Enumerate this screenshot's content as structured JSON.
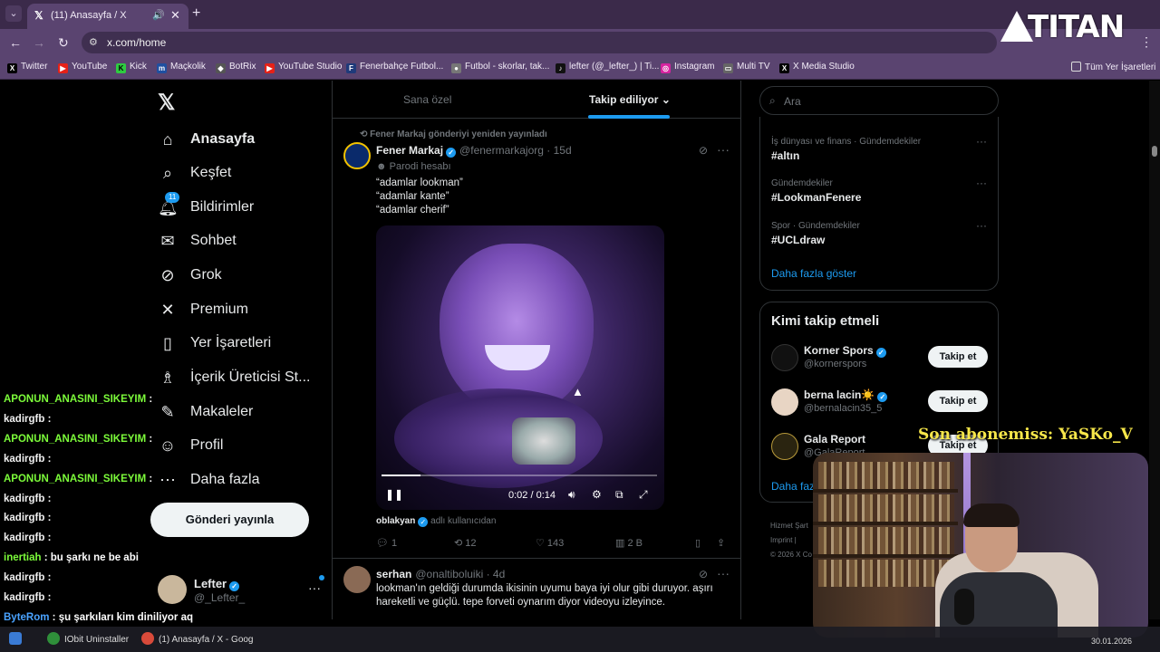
{
  "browser": {
    "tab_title": "(11) Anasayfa / X",
    "url": "x.com/home",
    "bookmarks": [
      "Twitter",
      "YouTube",
      "Kick",
      "Maçkolik",
      "BotRix",
      "YouTube Studio",
      "Fenerbahçe Futbol...",
      "Futbol - skorlar, tak...",
      "lefter (@_lefter_) | Ti...",
      "Instagram",
      "Multi TV",
      "X Media Studio"
    ],
    "all_bookmarks": "Tüm Yer İşaretleri"
  },
  "nav": {
    "items": [
      {
        "label": "Anasayfa",
        "icon": "home-icon"
      },
      {
        "label": "Keşfet",
        "icon": "search-icon"
      },
      {
        "label": "Bildirimler",
        "icon": "bell-icon",
        "badge": "11"
      },
      {
        "label": "Sohbet",
        "icon": "mail-icon"
      },
      {
        "label": "Grok",
        "icon": "grok-icon"
      },
      {
        "label": "Premium",
        "icon": "x-icon"
      },
      {
        "label": "Yer İşaretleri",
        "icon": "bookmark-icon"
      },
      {
        "label": "İçerik Üreticisi St...",
        "icon": "creator-icon"
      },
      {
        "label": "Makaleler",
        "icon": "article-icon"
      },
      {
        "label": "Profil",
        "icon": "person-icon"
      },
      {
        "label": "Daha fazla",
        "icon": "more-circle-icon"
      }
    ],
    "post_button": "Gönderi yayınla",
    "account": {
      "name": "Lefter",
      "handle": "@_Lefter_"
    }
  },
  "timeline": {
    "tabs": [
      "Sana özel",
      "Takip ediliyor"
    ],
    "post1": {
      "repost_line": "Fener Markaj gönderiyi yeniden yayınladı",
      "name": "Fener Markaj",
      "handle": "@fenermarkajorg · 15d",
      "parody": "Parodi hesabı",
      "text_lines": [
        "“adamlar lookman”",
        "“adamlar kante”",
        "“adamlar cherif”"
      ],
      "video": {
        "time": "0:02 / 0:14",
        "progress": 0.14
      },
      "tagged_name": "oblakyan",
      "tagged_suffix": "adlı kullanıcıdan",
      "replies": "1",
      "reposts": "12",
      "likes": "143",
      "views": "2 B"
    },
    "post2": {
      "name": "serhan",
      "handle": "@onaltiboluiki · 4d",
      "text": "lookman'ın geldiği durumda ikisinin uyumu baya iyi olur gibi duruyor. aşırı hareketli ve güçlü. tepe forveti oynarım diyor videoyu izleyince."
    }
  },
  "sidebar": {
    "search_placeholder": "Ara",
    "trends": [
      {
        "category": "İş dünyası ve finans · Gündemdekiler",
        "name": "#altın"
      },
      {
        "category": "Gündemdekiler",
        "name": "#LookmanFenere"
      },
      {
        "category": "Spor · Gündemdekiler",
        "name": "#UCLdraw"
      }
    ],
    "trends_show_more": "Daha fazla göster",
    "who_to_follow": {
      "title": "Kimi takip etmeli",
      "items": [
        {
          "name": "Korner Spors",
          "handle": "@kornerspors",
          "button": "Takip et"
        },
        {
          "name": "berna lacin☀️",
          "handle": "@bernalacin35_5",
          "button": "Takip et"
        },
        {
          "name": "Gala Report",
          "handle": "@GalaReport",
          "button": "Takip et"
        }
      ],
      "show_more": "Daha fazla göster"
    },
    "footer": [
      "Hizmet Şart",
      "Imprint |",
      "© 2026 X Co"
    ]
  },
  "stream": {
    "chat": [
      {
        "name": "APONUN_ANASINI_SIKEYIM",
        "msg": "",
        "color": "#7cfc3a"
      },
      {
        "name": "kadirgfb",
        "msg": "",
        "color": "#f0f0f0"
      },
      {
        "name": "APONUN_ANASINI_SIKEYIM",
        "msg": "",
        "color": "#7cfc3a"
      },
      {
        "name": "kadirgfb",
        "msg": "",
        "color": "#f0f0f0"
      },
      {
        "name": "APONUN_ANASINI_SIKEYIM",
        "msg": "",
        "color": "#7cfc3a"
      },
      {
        "name": "kadirgfb",
        "msg": "",
        "color": "#f0f0f0"
      },
      {
        "name": "kadirgfb",
        "msg": "",
        "color": "#f0f0f0"
      },
      {
        "name": "kadirgfb",
        "msg": "",
        "color": "#f0f0f0"
      },
      {
        "name": "inertiah",
        "msg": "bu şarkı ne be abi",
        "color": "#7cfc3a"
      },
      {
        "name": "kadirgfb",
        "msg": "",
        "color": "#f0f0f0"
      },
      {
        "name": "kadirgfb",
        "msg": "",
        "color": "#f0f0f0"
      },
      {
        "name": "ByteRom",
        "msg": "şu şarkıları kim diniliyor aq",
        "color": "#4aa3ff"
      }
    ],
    "sub_text": "Son abonemiss: YaSKo_V",
    "logo_text": "TITAN"
  },
  "taskbar": {
    "items": [
      "IObit Uninstaller",
      "(1) Anasayfa / X - Goog"
    ],
    "date": "30.01.2026"
  },
  "colors": {
    "accent": "#1d9bf0",
    "browser_frame": "#5a4470",
    "chat_green": "#7cfc3a",
    "sub_yellow": "#f7e74a"
  }
}
